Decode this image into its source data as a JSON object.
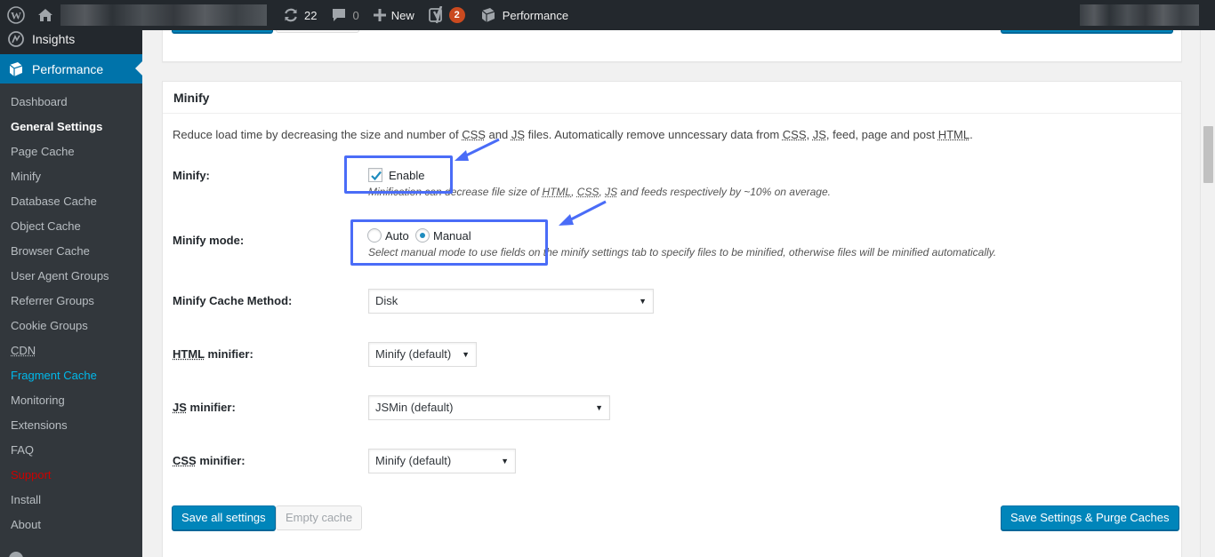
{
  "adminbar": {
    "updates_count": "22",
    "comments_count": "0",
    "new_label": "New",
    "yoast_badge": "2",
    "performance_label": "Performance"
  },
  "sidebar": {
    "insights_label": "Insights",
    "performance_label": "Performance",
    "items": [
      {
        "label": "Dashboard",
        "style": "normal"
      },
      {
        "label": "General Settings",
        "style": "bold"
      },
      {
        "label": "Page Cache",
        "style": "normal"
      },
      {
        "label": "Minify",
        "style": "normal"
      },
      {
        "label": "Database Cache",
        "style": "normal"
      },
      {
        "label": "Object Cache",
        "style": "normal"
      },
      {
        "label": "Browser Cache",
        "style": "normal"
      },
      {
        "label": "User Agent Groups",
        "style": "normal"
      },
      {
        "label": "Referrer Groups",
        "style": "normal"
      },
      {
        "label": "Cookie Groups",
        "style": "normal"
      },
      {
        "label": "CDN",
        "style": "underline"
      },
      {
        "label": "Fragment Cache",
        "style": "blue"
      },
      {
        "label": "Monitoring",
        "style": "normal"
      },
      {
        "label": "Extensions",
        "style": "normal"
      },
      {
        "label": "FAQ",
        "style": "normal"
      },
      {
        "label": "Support",
        "style": "red"
      },
      {
        "label": "Install",
        "style": "normal"
      },
      {
        "label": "About",
        "style": "normal"
      }
    ]
  },
  "minify_box": {
    "title": "Minify",
    "intro": {
      "p1": "Reduce load time by decreasing the size and number of ",
      "css": "CSS",
      "and": " and ",
      "js": "JS",
      "p2": " files. Automatically remove unncessary data from ",
      "comma": ", ",
      "p3": ", feed, page and post ",
      "html": "HTML",
      "dot": "."
    },
    "minify_label": "Minify:",
    "enable_label": "Enable",
    "enable_checked": true,
    "minify_desc": {
      "p1": "Minification can decrease file size of ",
      "html": "HTML",
      "c1": ", ",
      "css": "CSS",
      "c2": ", ",
      "js": "JS",
      "p2": " and feeds respectively by ~10% on average."
    },
    "mode_label": "Minify mode:",
    "mode_options": [
      "Auto",
      "Manual"
    ],
    "mode_selected": "Manual",
    "mode_desc": "Select manual mode to use fields on the minify settings tab to specify files to be minified, otherwise files will be minified automatically.",
    "cache_method_label": "Minify Cache Method:",
    "cache_method_value": "Disk",
    "html_minifier_abbr": "HTML",
    "html_minifier_rest": " minifier:",
    "html_minifier_value": "Minify (default)",
    "js_minifier_abbr": "JS",
    "js_minifier_rest": " minifier:",
    "js_minifier_value": "JSMin (default)",
    "css_minifier_abbr": "CSS",
    "css_minifier_rest": " minifier:",
    "css_minifier_value": "Minify (default)",
    "save_all_label": "Save all settings",
    "empty_cache_label": "Empty cache",
    "save_purge_label": "Save Settings & Purge Caches"
  },
  "colors": {
    "accent": "#0073aa",
    "button_primary": "#0085ba",
    "annotation": "#4a6cf7",
    "badge": "#ca4a1f"
  },
  "icons": [
    "wordpress-logo-icon",
    "home-icon",
    "updates-icon",
    "comments-icon",
    "plus-icon",
    "yoast-icon",
    "performance-icon",
    "insights-icon",
    "checkmark-icon",
    "caret-down-icon",
    "arrow-annotation-icon"
  ]
}
